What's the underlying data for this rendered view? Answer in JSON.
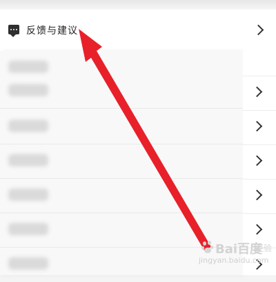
{
  "feedback": {
    "label": "反馈与建议",
    "icon": "message-dots-icon"
  },
  "rows": [
    {
      "label": "",
      "icon": "chevron-right-icon"
    },
    {
      "label": "",
      "icon": "chevron-right-icon"
    },
    {
      "label": "",
      "icon": "chevron-right-icon"
    },
    {
      "label": "",
      "icon": "chevron-right-icon"
    },
    {
      "label": "",
      "icon": "chevron-right-icon"
    },
    {
      "label": "",
      "icon": "chevron-right-icon"
    }
  ],
  "annotation": {
    "color": "#e8202a"
  },
  "watermark": {
    "brand": "Bai百度",
    "sub": "经验",
    "url": "jingyan.baidu.com"
  }
}
